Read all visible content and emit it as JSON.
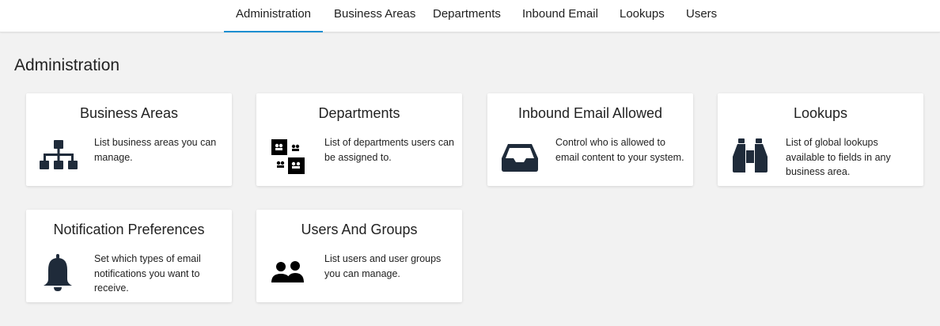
{
  "nav": {
    "tabs": [
      {
        "label": "Administration",
        "active": true
      },
      {
        "label": "Business Areas"
      },
      {
        "label": "Departments"
      },
      {
        "label": "Inbound Email"
      },
      {
        "label": "Lookups"
      },
      {
        "label": "Users"
      }
    ],
    "accent_color": "#1a8fd1"
  },
  "page": {
    "title": "Administration"
  },
  "cards": [
    {
      "title": "Business Areas",
      "icon": "sitemap-icon",
      "description": "List business areas you can manage."
    },
    {
      "title": "Departments",
      "icon": "departments-icon",
      "description": "List of departments users can be assigned to."
    },
    {
      "title": "Inbound Email Allowed",
      "icon": "inbox-icon",
      "description": "Control who is allowed to email content to your system."
    },
    {
      "title": "Lookups",
      "icon": "binoculars-icon",
      "description": "List of global lookups available to fields in any business area."
    },
    {
      "title": "Notification Preferences",
      "icon": "bell-icon",
      "description": "Set which types of email notifications you want to receive."
    },
    {
      "title": "Users And Groups",
      "icon": "users-icon",
      "description": "List users and user groups you can manage."
    }
  ]
}
